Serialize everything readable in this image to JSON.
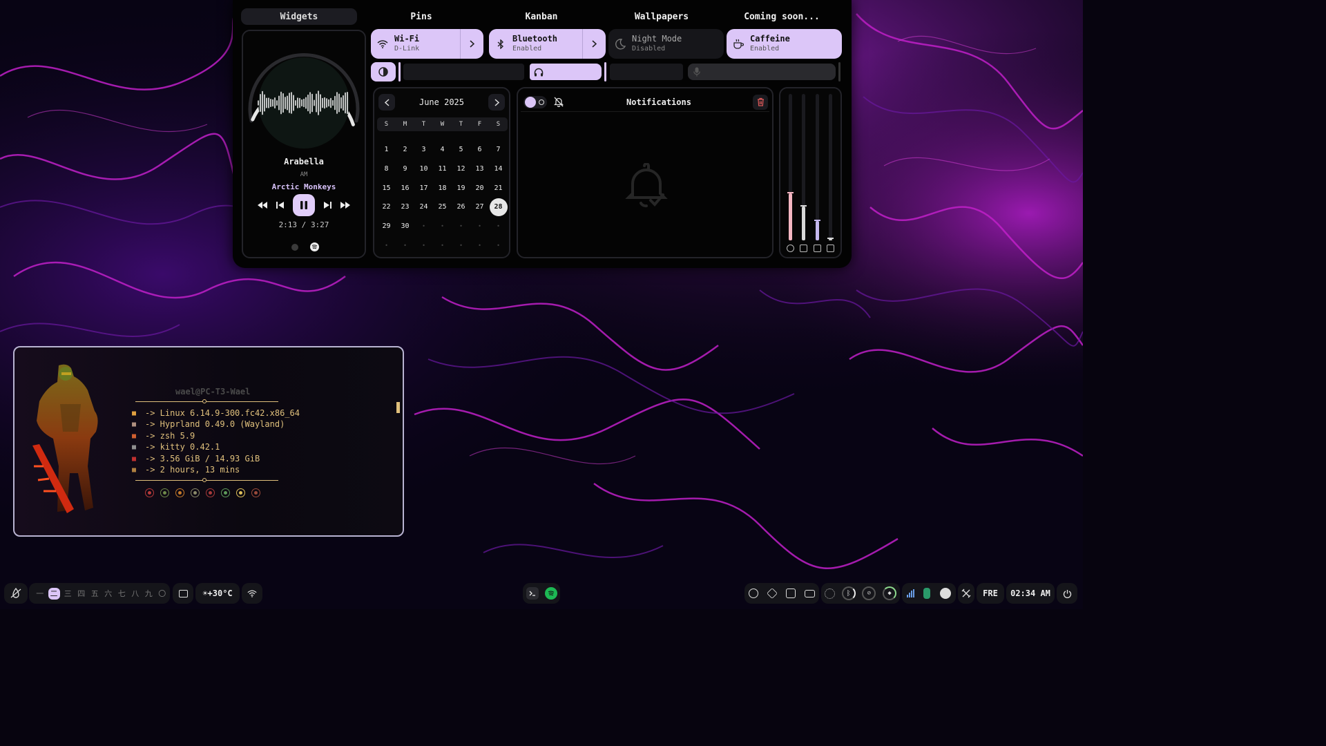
{
  "tabs": [
    "Widgets",
    "Pins",
    "Kanban",
    "Wallpapers",
    "Coming soon..."
  ],
  "media": {
    "title": "Arabella",
    "album": "AM",
    "artist": "Arctic Monkeys",
    "position": "2:13",
    "duration": "3:27",
    "time_separator": " / ",
    "progress": 0.64,
    "players": [
      "browser-icon",
      "spotify-icon"
    ]
  },
  "toggles": [
    {
      "title": "Wi-Fi",
      "subtitle": "D-Link",
      "state": "on",
      "icon": "wifi-icon",
      "has_arrow": true
    },
    {
      "title": "Bluetooth",
      "subtitle": "Enabled",
      "state": "on",
      "icon": "bluetooth-icon",
      "has_arrow": true
    },
    {
      "title": "Night Mode",
      "subtitle": "Disabled",
      "state": "off",
      "icon": "moon-icon",
      "has_arrow": false
    },
    {
      "title": "Caffeine",
      "subtitle": "Enabled",
      "state": "on",
      "icon": "coffee-icon",
      "has_arrow": false
    }
  ],
  "sliders": {
    "brightness": 0.0,
    "volume": 1.0,
    "microphone": 0.0
  },
  "calendar": {
    "month_label": "June 2025",
    "weekdays": [
      "S",
      "M",
      "T",
      "W",
      "T",
      "F",
      "S"
    ],
    "days": [
      "1",
      "2",
      "3",
      "4",
      "5",
      "6",
      "7",
      "8",
      "9",
      "10",
      "11",
      "12",
      "13",
      "14",
      "15",
      "16",
      "17",
      "18",
      "19",
      "20",
      "21",
      "22",
      "23",
      "24",
      "25",
      "26",
      "27",
      "28",
      "29",
      "30"
    ],
    "today": "28",
    "trailing_dots": 12
  },
  "notifications": {
    "title": "Notifications",
    "dnd_enabled": false
  },
  "meters": [
    {
      "name": "disk",
      "level": 0.32,
      "color": "#f4b6c2",
      "icon": "disk-icon"
    },
    {
      "name": "memory",
      "level": 0.23,
      "color": "#d8d8d8",
      "icon": "memory-icon"
    },
    {
      "name": "cpu",
      "level": 0.13,
      "color": "#c5b8ef",
      "icon": "cpu-icon"
    },
    {
      "name": "battery",
      "level": 0.01,
      "color": "#d8d8d8",
      "icon": "battery-icon"
    }
  ],
  "terminal": {
    "user_host": "wael@PC-T3-Wael",
    "lines": [
      {
        "icon": "linux-icon",
        "color": "#e0a040",
        "text": "-> Linux 6.14.9-300.fc42.x86_64"
      },
      {
        "icon": "window-icon",
        "color": "#b09080",
        "text": "-> Hyprland 0.49.0 (Wayland)"
      },
      {
        "icon": "shell-icon",
        "color": "#d06030",
        "text": "-> zsh 5.9"
      },
      {
        "icon": "terminal-icon",
        "color": "#909090",
        "text": "-> kitty 0.42.1"
      },
      {
        "icon": "memory-icon",
        "color": "#c03030",
        "text": "-> 3.56 GiB / 14.93 GiB"
      },
      {
        "icon": "clock-icon",
        "color": "#b08040",
        "text": "-> 2 hours, 13 mins"
      }
    ],
    "palette": [
      "#b83a3a",
      "#6e8a4a",
      "#c77a2a",
      "#8a8a6a",
      "#a83a3a",
      "#5e9a5a",
      "#e0c05a",
      "#9a4a3a"
    ]
  },
  "bar": {
    "workspaces": [
      "一",
      "二",
      "三",
      "四",
      "五",
      "六",
      "七",
      "八",
      "九",
      "〇"
    ],
    "active_workspace": "二",
    "weather": "☀+30°C",
    "keyboard_layout": "FRE",
    "clock": "02:34 AM"
  }
}
